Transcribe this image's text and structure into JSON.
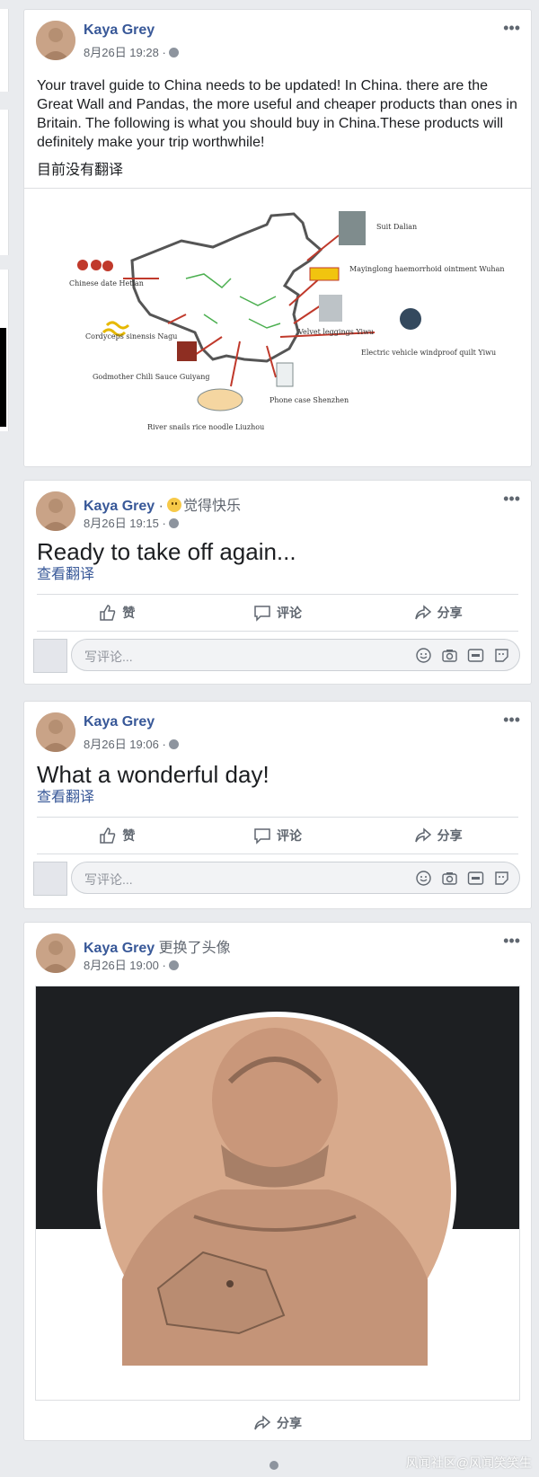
{
  "user": {
    "name": "Kaya Grey"
  },
  "posts": [
    {
      "timestamp": "8月26日 19:28 ·",
      "text": "Your travel guide to China needs to be updated! In China. there are the Great Wall and Pandas, the more useful and cheaper products than ones in Britain. The following is what you should buy in China.These products will definitely make your trip worthwhile!",
      "translation_note": "目前没有翻译",
      "map_labels": {
        "suit": "Suit Dalian",
        "ointment": "Mayinglong haemorrhoid ointment Wuhan",
        "leggings": "Velvet leggings Yiwu",
        "quilt": "Electric vehicle windproof quilt Yiwu",
        "phone": "Phone case Shenzhen",
        "noodle": "River snails rice noodle Liuzhou",
        "chili": "Godmother Chili Sauce Guiyang",
        "cordyceps": "Cordyceps sinensis Nagu",
        "chinese_date": "Chinese date Hetian"
      }
    },
    {
      "feeling": "觉得快乐",
      "timestamp": "8月26日 19:15 ·",
      "text": "Ready to take off again...",
      "see_translation": "查看翻译"
    },
    {
      "timestamp": "8月26日 19:06 ·",
      "text": "What a wonderful day!",
      "see_translation": "查看翻译"
    },
    {
      "activity": "更换了头像",
      "timestamp": "8月26日 19:00 ·"
    }
  ],
  "actions": {
    "like": "赞",
    "comment": "评论",
    "share": "分享"
  },
  "comment_placeholder": "写评论...",
  "more_label": "•••",
  "watermark": "风闻社区@风闻笑笑生",
  "colors": {
    "name": "#385898",
    "background": "#e9ebee",
    "muted": "#606770"
  }
}
